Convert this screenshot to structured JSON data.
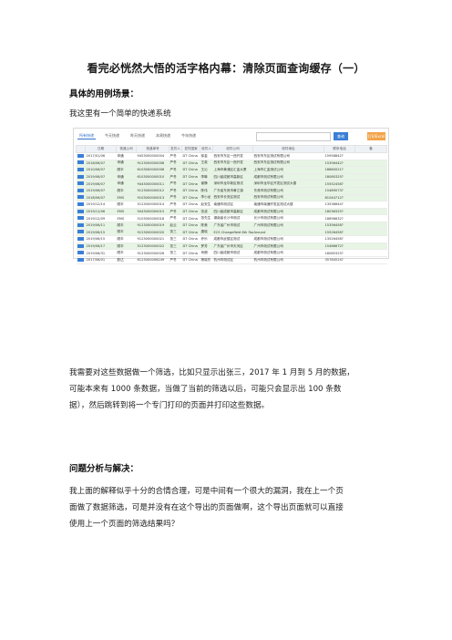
{
  "doc": {
    "title": "看完必恍然大悟的活字格内幕：清除页面查询缓存（一）",
    "section1_heading": "具体的用例场景：",
    "intro": "我这里有一个简单的快递系统",
    "para1": [
      "我需要对这些数据做一个筛选，比如只显示出张三，2017 年 1 月到 5 月的数据，",
      "可能本来有 1000 条数据，当做了当前的筛选以后，可能只会显示出 100 条数",
      "据），然后跳转到将一个专门打印的页面并打印这些数据。"
    ],
    "section2_heading": "问题分析与解决：",
    "para2": [
      "我上面的解释似乎十分的合情合理，可是中间有一个很大的漏洞，我在上一个页",
      "面做了数据筛选，可是并没有在这个导出的页面做啊，这个导出页面就可以直接",
      "使用上一个页面的筛选结果吗？"
    ]
  },
  "screenshot": {
    "tabs": [
      "所有快递",
      "今天快递",
      "昨天快递",
      "本周快递",
      "今年快递"
    ],
    "search_placeholder": "",
    "query_label": "查询",
    "print_label": "打印Excel",
    "columns": [
      "",
      "日期",
      "快递公司",
      "快递单号",
      "发件人",
      "发件国家",
      "收件人",
      "收件公司",
      "收件地址",
      "联系电话",
      "备"
    ],
    "rows": [
      [
        "2017/01/06",
        "申通",
        "9453000000004",
        "严冬",
        "DT China",
        "徐金",
        "西安市东区一西开发",
        "西安市东区测试有限公司",
        "15958842?"
      ],
      [
        "2018/06/07",
        "申通",
        "9123000000006",
        "严冬",
        "DT China",
        "王英",
        "西安市东区一西开发",
        "西安市东区测试有限公司",
        "15356442?"
      ],
      [
        "2010/06/07",
        "顺丰",
        "6103000000006",
        "严冬",
        "DT China",
        "王沁",
        "上海市黄浦区汇金大厦",
        "上海市汇金测试公司",
        "18860021?"
      ],
      [
        "2019/06/07",
        "申通",
        "6103000000010",
        "严冬",
        "DT China",
        "李琳",
        "四川省成都市高新区",
        "成都市测试有限公司",
        "18080325?"
      ],
      [
        "2019/06/07",
        "申通",
        "9443000000011",
        "严冬",
        "DT China",
        "谢静",
        "深圳市龙华新区测试",
        "深圳市龙华区开发区测试大楼",
        "15552458?"
      ],
      [
        "2019/06/07",
        "顺丰",
        "9123000000012",
        "严冬",
        "DT China",
        "陈伟",
        "广东省东莞市黄江镇",
        "东莞市测试有限公司",
        "15489073?"
      ],
      [
        "2018/06/07",
        "EMS",
        "9103000000013",
        "严冬",
        "DT China",
        "李小龙",
        "西安市长安区测试",
        "西安市测试有限公司",
        "81044712?"
      ],
      [
        "2019/12/14",
        "顺丰",
        "5123000000014",
        "严冬",
        "DT China",
        "赵安生",
        "南通市测试区",
        "南通市南通开发区测试大楼",
        "13536844?"
      ],
      [
        "2019/11/06",
        "EMS",
        "9443000000015",
        "严冬",
        "DT China",
        "张波",
        "四川省成都市高新区",
        "成都市测试有限公司",
        "18036325?"
      ],
      [
        "2019/12/09",
        "EMS",
        "5103000000018",
        "严冬",
        "DT China",
        "张先生",
        "湖南省长沙市测试",
        "长沙市测试有限公司",
        "18896632?"
      ],
      [
        "2019/06/11",
        "顺丰",
        "9123000000019",
        "赵云",
        "DT China",
        "陈美",
        "广东省广州市测试",
        "广州市测试有限公司",
        "15356458?"
      ],
      [
        "2019/06/15",
        "顺丰",
        "9123000000020",
        "张三",
        "DT China",
        "唐晓",
        "ECS Changefield 6th floor",
        "Around",
        "15526458?"
      ],
      [
        "2019/06/15",
        "顺丰",
        "9123000000021",
        "张三",
        "DT China",
        "乔乐",
        "成都市武侯区测试",
        "成都市测试有限公司",
        "13526458?"
      ],
      [
        "2019/06/17",
        "顺丰",
        "5123000000022",
        "张三",
        "DT China",
        "罗芳",
        "广东省广州市天河区",
        "广州市测试有限公司",
        "15486672?"
      ],
      [
        "2019/06/31",
        "顺丰",
        "9123000000026",
        "张三",
        "DT China",
        "肖朗",
        "四川省成都市测试",
        "成都市测试有限公司",
        "18085325?"
      ],
      [
        "2017/06/01",
        "韵达",
        "6123000006249",
        "严冬",
        "DT China",
        "杨晓东",
        "杭州市测试区",
        "杭州市测试有限公司",
        "35784524?"
      ]
    ]
  },
  "colors": {
    "accent": "#3a7fd6",
    "print": "#f3a34a",
    "row_highlight": "#e7f5e4"
  }
}
